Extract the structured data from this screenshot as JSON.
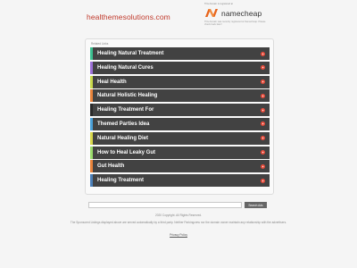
{
  "header": {
    "domain": "healthemesolutions.com",
    "registrar_top": "This domain is registered at",
    "registrar_name": "namecheap",
    "registrar_note": "This domain was recently registered at Namecheap. Please check back later!",
    "colors": {
      "domain": "#c0392b",
      "logo_orange": "#e8641b"
    }
  },
  "related": {
    "title": "Related Links",
    "items": [
      {
        "label": "Healing Natural Treatment",
        "accent": "#3bbf8f"
      },
      {
        "label": "Healing Natural Cures",
        "accent": "#9c6fd6"
      },
      {
        "label": "Heal Health",
        "accent": "#c8d84a"
      },
      {
        "label": "Natural Holistic Healing",
        "accent": "#e8833a"
      },
      {
        "label": "Healing Treatment For",
        "accent": "#2a2a2a"
      },
      {
        "label": "Themed Parties Idea",
        "accent": "#4aa0d8"
      },
      {
        "label": "Natural Healing Diet",
        "accent": "#d8d84a"
      },
      {
        "label": "How to Heal Leaky Gut",
        "accent": "#9adb6a"
      },
      {
        "label": "Gut Health",
        "accent": "#e8833a"
      },
      {
        "label": "Healing Treatment",
        "accent": "#4a7fb8"
      }
    ],
    "arrow_icon": "play-icon",
    "arrow_color": "#e74c3c"
  },
  "search": {
    "placeholder": "",
    "button_label": "Search Ads"
  },
  "footer": {
    "copyright": "2020 Copyright. All Rights Reserved.",
    "disclaimer": "The Sponsored Listings displayed above are served automatically by a third party. Neither Parkingcrew nor the domain owner maintain any relationship with the advertisers.",
    "privacy": "Privacy Policy"
  }
}
